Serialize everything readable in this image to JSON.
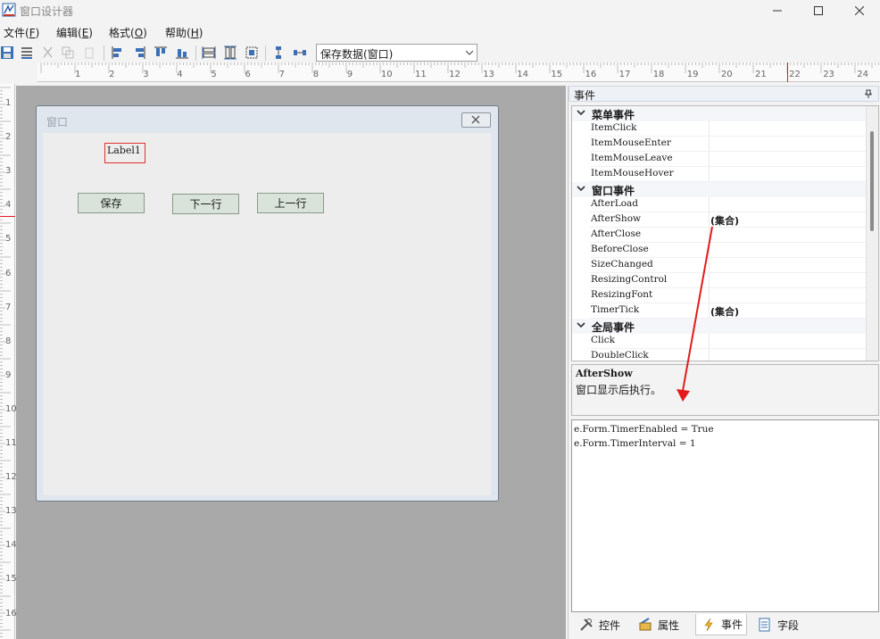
{
  "window": {
    "title": "窗口设计器"
  },
  "menu": [
    {
      "label": "文件(",
      "key": "F",
      "tail": ")"
    },
    {
      "label": "编辑(",
      "key": "E",
      "tail": ")"
    },
    {
      "label": "格式(",
      "key": "O",
      "tail": ")"
    },
    {
      "label": "帮助(",
      "key": "H",
      "tail": ")"
    }
  ],
  "toolbar": {
    "combo_value": "保存数据(窗口)"
  },
  "rulers": {
    "h": [
      "1",
      "2",
      "3",
      "4",
      "5",
      "6",
      "7",
      "8",
      "9",
      "10",
      "11",
      "12",
      "13",
      "14",
      "15",
      "16",
      "17",
      "18",
      "19",
      "20",
      "21",
      "22",
      "23",
      "24"
    ],
    "v": [
      "1",
      "2",
      "3",
      "4",
      "5",
      "6",
      "7",
      "8",
      "9",
      "10",
      "11",
      "12",
      "13",
      "14",
      "15",
      "16"
    ]
  },
  "form": {
    "title": "窗口",
    "label1": "Label1",
    "buttons": [
      "保存",
      "下一行",
      "上一行"
    ]
  },
  "panel": {
    "title": "事件",
    "categories": [
      {
        "name": "菜单事件",
        "items": [
          {
            "name": "ItemClick",
            "value": ""
          },
          {
            "name": "ItemMouseEnter",
            "value": ""
          },
          {
            "name": "ItemMouseLeave",
            "value": ""
          },
          {
            "name": "ItemMouseHover",
            "value": ""
          }
        ]
      },
      {
        "name": "窗口事件",
        "items": [
          {
            "name": "AfterLoad",
            "value": ""
          },
          {
            "name": "AfterShow",
            "value": "(集合)"
          },
          {
            "name": "AfterClose",
            "value": ""
          },
          {
            "name": "BeforeClose",
            "value": ""
          },
          {
            "name": "SizeChanged",
            "value": ""
          },
          {
            "name": "ResizingControl",
            "value": ""
          },
          {
            "name": "ResizingFont",
            "value": ""
          },
          {
            "name": "TimerTick",
            "value": "(集合)"
          }
        ]
      },
      {
        "name": "全局事件",
        "items": [
          {
            "name": "Click",
            "value": ""
          },
          {
            "name": "DoubleClick",
            "value": ""
          }
        ]
      }
    ],
    "description": {
      "title": "AfterShow",
      "text": "窗口显示后执行。"
    },
    "code": [
      "e.Form.TimerEnabled = True",
      "e.Form.TimerInterval = 1"
    ],
    "tabs": [
      {
        "label": "控件",
        "icon": "tools-icon"
      },
      {
        "label": "属性",
        "icon": "properties-icon"
      },
      {
        "label": "事件",
        "icon": "lightning-icon"
      },
      {
        "label": "字段",
        "icon": "fields-icon"
      }
    ],
    "active_tab": "事件"
  },
  "colors": {
    "accent_red": "#e21b1b",
    "selection_border": "#e03030"
  }
}
